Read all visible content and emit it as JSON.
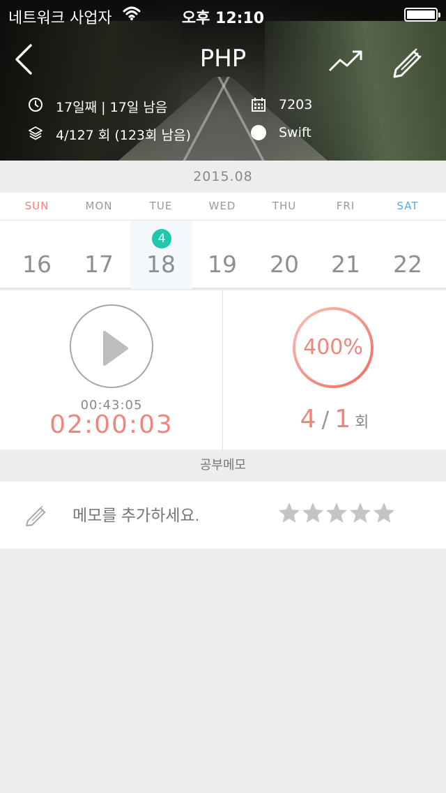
{
  "status_bar": {
    "carrier": "네트워크 사업자",
    "time": "오후 12:10"
  },
  "nav": {
    "title": "PHP"
  },
  "info": {
    "days": "17일째 | 17일 남음",
    "sessions": "4/127 회 (123회 남음)",
    "total": "7203",
    "tag": "Swift"
  },
  "calendar": {
    "month": "2015.08",
    "weekdays": [
      "SUN",
      "MON",
      "TUE",
      "WED",
      "THU",
      "FRI",
      "SAT"
    ],
    "days": [
      "16",
      "17",
      "18",
      "19",
      "20",
      "21",
      "22"
    ],
    "selected_index": 2,
    "badge": "4"
  },
  "timer": {
    "elapsed": "00:43:05",
    "goal": "02:00:03"
  },
  "progress": {
    "percent_label": "400%",
    "done": "4",
    "slash": "/",
    "goal": "1",
    "unit": "회"
  },
  "memo": {
    "section_title": "공부메모",
    "placeholder": "메모를 추가하세요.",
    "rating": 0,
    "max_rating": 5
  },
  "colors": {
    "accent": "#f0857c",
    "badge": "#1fc6b0",
    "sunday": "#f0817a",
    "saturday": "#5aa9e8"
  }
}
